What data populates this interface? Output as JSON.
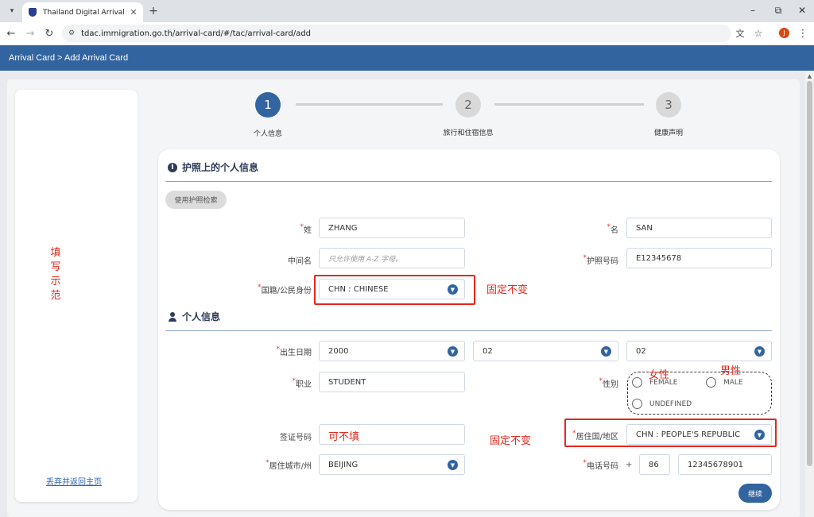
{
  "browser": {
    "tab_title": "Thailand Digital Arrival Card",
    "tab_close": "✕",
    "new_tab": "+",
    "url": "tdac.immigration.go.th/arrival-card/#/tac/arrival-card/add",
    "profile_initial": "J",
    "controls": {
      "minimize": "–",
      "restore": "⧉",
      "close": "✕"
    }
  },
  "header": {
    "breadcrumb": "Arrival Card > Add Arrival Card"
  },
  "sidebar": {
    "sample_note": [
      "填",
      "写",
      "示",
      "范"
    ],
    "abandon_link": "丢弃并返回主页"
  },
  "stepper": [
    {
      "number": "1",
      "label": "个人信息",
      "active": true
    },
    {
      "number": "2",
      "label": "旅行和住宿信息",
      "active": false
    },
    {
      "number": "3",
      "label": "健康声明",
      "active": false
    }
  ],
  "passport_section": {
    "title": "护照上的个人信息",
    "scan_button": "使用护照检索",
    "surname_label": "姓",
    "surname_value": "ZHANG",
    "given_name_label": "名",
    "given_name_value": "SAN",
    "middle_name_label": "中间名",
    "middle_name_placeholder": "只允许使用 A-Z 字母。",
    "passport_no_label": "护照号码",
    "passport_no_value": "E12345678",
    "nationality_label": "国籍/公民身份",
    "nationality_value": "CHN : CHINESE",
    "nationality_note": "固定不变"
  },
  "personal_section": {
    "title": "个人信息",
    "dob_label": "出生日期",
    "dob_year": "2000",
    "dob_month": "02",
    "dob_day": "02",
    "occupation_label": "职业",
    "occupation_value": "STUDENT",
    "gender_label": "性别",
    "gender_options": [
      "FEMALE",
      "MALE",
      "UNDEFINED"
    ],
    "female_note": "女性",
    "male_note": "男性",
    "visa_label": "签证号码",
    "visa_note": "可不填",
    "residence_note": "固定不变",
    "residence_label": "居住国/地区",
    "residence_value": "CHN : PEOPLE'S REPUBLIC",
    "city_label": "居住城市/州",
    "city_value": "BEIJING",
    "phone_label": "电话号码",
    "phone_plus": "+",
    "phone_code": "86",
    "phone_number": "12345678901",
    "required_mark": "*"
  },
  "continue_button": "继续"
}
